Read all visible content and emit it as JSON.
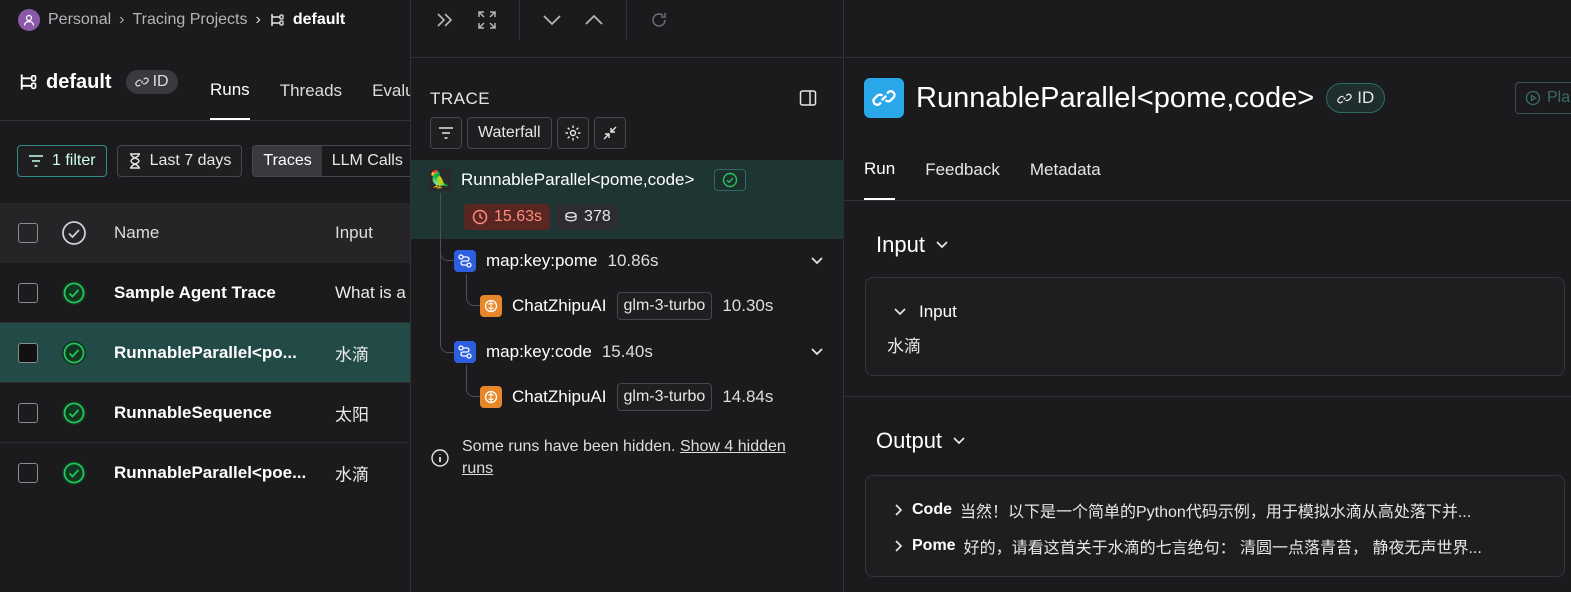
{
  "breadcrumb": {
    "workspace": "Personal",
    "section": "Tracing Projects",
    "current": "default"
  },
  "project": {
    "title": "default",
    "id_label": "ID"
  },
  "left_tabs": [
    "Runs",
    "Threads",
    "Evalu"
  ],
  "filters": {
    "filter_label": "1 filter",
    "time_label": "Last 7 days",
    "seg_traces": "Traces",
    "seg_llm": "LLM Calls"
  },
  "table": {
    "headers": {
      "name": "Name",
      "input": "Input"
    },
    "rows": [
      {
        "name": "Sample Agent Trace",
        "input": "What is a"
      },
      {
        "name": "RunnableParallel<po...",
        "input": "水滴"
      },
      {
        "name": "RunnableSequence",
        "input": "太阳"
      },
      {
        "name": "RunnableParallel<poe...",
        "input": "水滴"
      }
    ]
  },
  "trace": {
    "label": "TRACE",
    "view_mode": "Waterfall",
    "root": {
      "name": "RunnableParallel<pome,code>",
      "latency": "15.63s",
      "tokens": "378"
    },
    "nodes": [
      {
        "name": "map:key:pome",
        "latency": "10.86s"
      },
      {
        "name": "ChatZhipuAI",
        "model": "glm-3-turbo",
        "latency": "10.30s"
      },
      {
        "name": "map:key:code",
        "latency": "15.40s"
      },
      {
        "name": "ChatZhipuAI",
        "model": "glm-3-turbo",
        "latency": "14.84s"
      }
    ],
    "hidden_notice": "Some runs have been hidden.",
    "hidden_link_1": "Show 4 hidden",
    "hidden_link_2": "runs"
  },
  "detail": {
    "title": "RunnableParallel<pome,code>",
    "id_label": "ID",
    "play_label": "Pla",
    "tabs": [
      "Run",
      "Feedback",
      "Metadata"
    ],
    "input_section": "Input",
    "input_key": "Input",
    "input_value": "水滴",
    "output_section": "Output",
    "outputs": [
      {
        "key": "Code",
        "value": "当然！以下是一个简单的Python代码示例，用于模拟水滴从高处落下并..."
      },
      {
        "key": "Pome",
        "value": "好的，请看这首关于水滴的七言绝句： 清圆一点落青苔， 静夜无声世界..."
      }
    ]
  },
  "colors": {
    "accent_teal": "#2e8b87",
    "success_green": "#22c55e",
    "latency_red": "#ff8b7e",
    "link_blue": "#29a7e8"
  }
}
